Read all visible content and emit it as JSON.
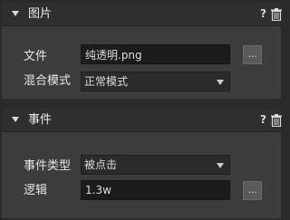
{
  "image_section": {
    "title": "图片",
    "help": "?",
    "file_label": "文件",
    "file_value": "纯透明.png",
    "browse_label": "...",
    "blend_label": "混合模式",
    "blend_value": "正常模式"
  },
  "event_section": {
    "title": "事件",
    "help": "?",
    "event_type_label": "事件类型",
    "event_type_value": "被点击",
    "logic_label": "逻辑",
    "logic_value": "1.3w",
    "browse_label": "..."
  }
}
